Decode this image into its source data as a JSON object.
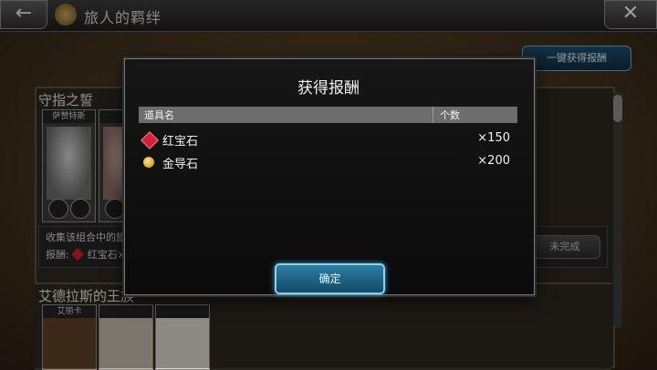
{
  "topbar": {
    "title": "旅人的羁绊",
    "back_icon": "arrow-left-icon",
    "close_icon": "close-icon"
  },
  "background": {
    "claim_all_label": "一键获得报酬",
    "group1": {
      "title": "守指之誓",
      "card_labels": [
        "萨赞特斯"
      ],
      "info_line1": "收集该组合中的旅人【 /3】",
      "info_prefix": "报酬:",
      "info_reward": "红宝石×30",
      "status_label": "未完成"
    },
    "group2": {
      "title": "艾德拉斯的王族",
      "card_labels": [
        "艾丽卡",
        "",
        ""
      ]
    }
  },
  "modal": {
    "title": "获得报酬",
    "columns": {
      "name": "道具名",
      "count": "个数"
    },
    "items": [
      {
        "name": "红宝石",
        "qty": "×150",
        "icon": "ruby-icon"
      },
      {
        "name": "金导石",
        "qty": "×200",
        "icon": "gold-stone-icon"
      }
    ],
    "confirm_label": "确定"
  }
}
